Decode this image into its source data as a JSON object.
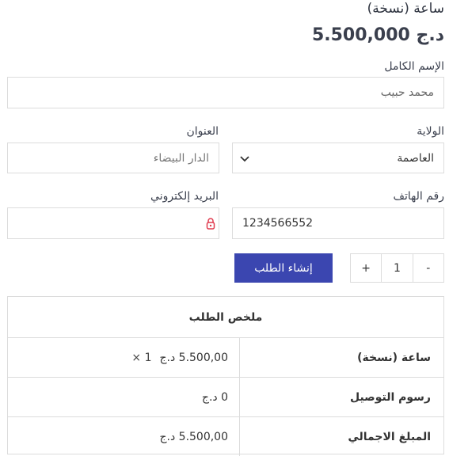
{
  "product": {
    "title": "ساعة (نسخة)",
    "price": "5.500,000 د.ج"
  },
  "form": {
    "full_name_label": "الإسم الكامل",
    "full_name_value": "محمد حبيب",
    "state_label": "الولاية",
    "state_value": "العاصمة",
    "address_label": "العنوان",
    "address_value": "الدار البيضاء",
    "phone_label": "رقم الهاتف",
    "phone_value": "1234566552",
    "email_label": "البريد إلكتروني",
    "email_value": "",
    "submit_label": "إنشاء الطلب",
    "qty_minus": "-",
    "qty_value": "1",
    "qty_plus": "+"
  },
  "summary": {
    "title": "ملخص الطلب",
    "rows": [
      {
        "label": "ساعة (نسخة)",
        "value": "5.500,00 د.ج",
        "multiplier": "× 1"
      },
      {
        "label": "رسوم التوصيل",
        "value": "0 د.ج"
      },
      {
        "label": "المبلغ الاجمالي",
        "value": "5.500,00 د.ج"
      }
    ]
  },
  "colors": {
    "accent": "#3b46b0",
    "lock_icon": "#e03a4e"
  }
}
